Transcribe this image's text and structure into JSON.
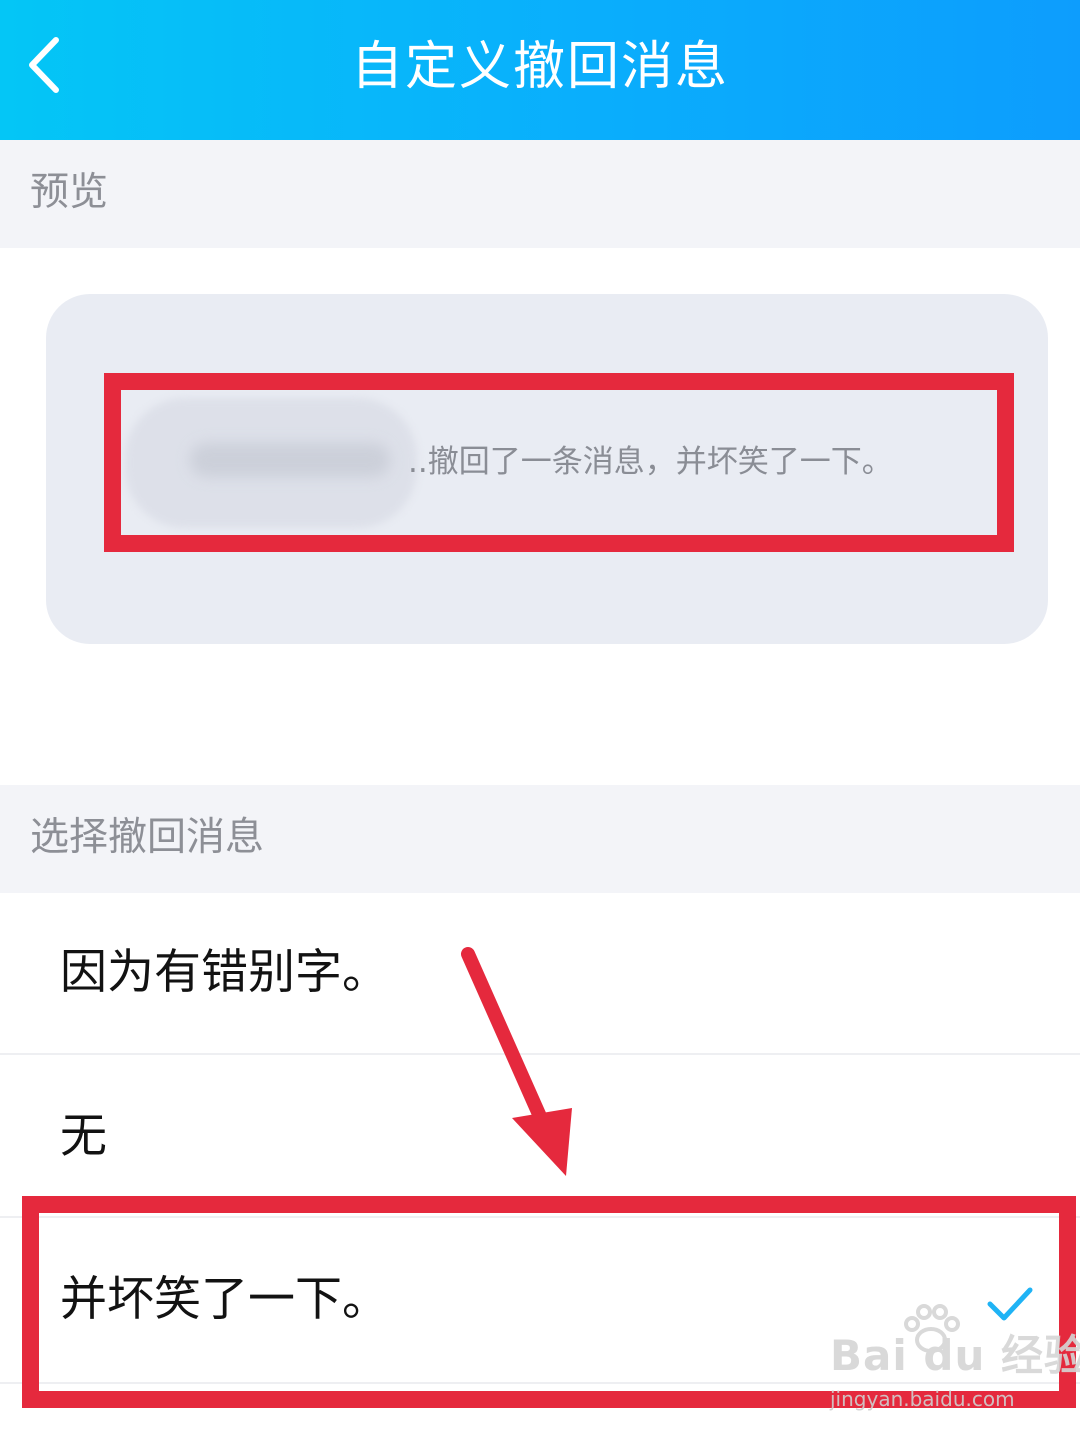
{
  "header": {
    "title": "自定义撤回消息",
    "back_icon": "chevron-left-icon"
  },
  "preview_section": {
    "label": "预览",
    "message_text": "..撤回了一条消息，并坏笑了一下。"
  },
  "options_section": {
    "label": "选择撤回消息",
    "options": [
      {
        "label": "因为有错别字。",
        "selected": false
      },
      {
        "label": "无",
        "selected": false
      },
      {
        "label": "并坏笑了一下。",
        "selected": true
      },
      {
        "label": "",
        "selected": false
      }
    ],
    "check_icon": "checkmark-icon"
  },
  "watermark": {
    "logo_text": "Bai du 经验",
    "url_text": "jingyan.baidu.com"
  },
  "colors": {
    "header_start": "#04c6f6",
    "header_end": "#0d9dfd",
    "annotation_red": "#e5293d",
    "check_blue": "#1fb3f5",
    "section_bg": "#f3f4f8"
  }
}
